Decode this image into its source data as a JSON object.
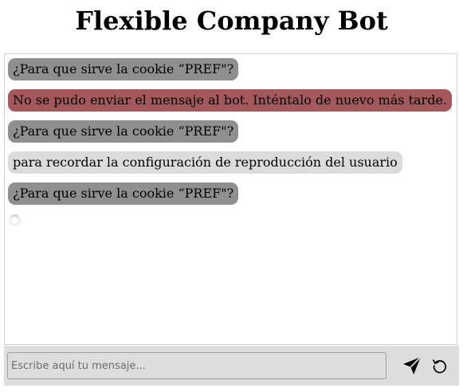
{
  "header": {
    "title": "Flexible Company Bot"
  },
  "chat": {
    "messages": [
      {
        "role": "user",
        "text": "¿Para que sirve la cookie “PREF\"?"
      },
      {
        "role": "error",
        "text": "No se pudo enviar el mensaje al bot. Inténtalo de nuevo más tarde."
      },
      {
        "role": "user",
        "text": "¿Para que sirve la cookie “PREF\"?"
      },
      {
        "role": "bot",
        "text": "para recordar la configuración de reproducción del usuario"
      },
      {
        "role": "user",
        "text": "¿Para que sirve la cookie “PREF\"?"
      }
    ],
    "loading": true
  },
  "composer": {
    "placeholder": "Escribe aquí tu mensaje...",
    "value": "",
    "send_icon": "send-icon",
    "reset_icon": "refresh-icon"
  },
  "colors": {
    "user_bubble": "#8f8f8f",
    "error_bubble": "#a5585c",
    "bot_bubble": "#dcdcdc",
    "input_bar": "#dddddd"
  }
}
